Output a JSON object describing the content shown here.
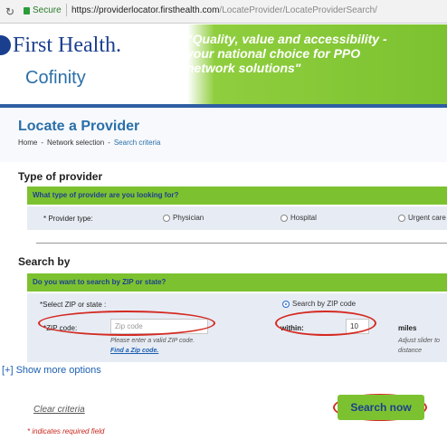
{
  "browser": {
    "reload_icon": "reload-icon",
    "secure_label": "Secure",
    "url_host": "https://providerlocator.firsthealth.com",
    "url_path": "/LocateProvider/LocateProviderSearch/"
  },
  "header": {
    "brand_primary": "First Health.",
    "brand_secondary": "Cofinity",
    "tagline": "\"Quality, value and accessibility - your national choice for PPO network solutions\"",
    "accent_color": "#7cc230",
    "brand_color": "#1b3f8f"
  },
  "page": {
    "title": "Locate a Provider",
    "breadcrumbs": [
      "Home",
      "Network selection",
      "Search criteria"
    ]
  },
  "provider_type": {
    "section_title": "Type of provider",
    "question": "What type of provider are you looking for?",
    "field_label": "* Provider type:",
    "options": [
      "Physician",
      "Hospital",
      "Urgent care"
    ]
  },
  "search_by": {
    "section_title": "Search by",
    "question": "Do you want to search by ZIP or state?",
    "select_label": "*Select ZIP or state :",
    "zip_radio_label": "Search by ZIP code",
    "zip_label": "*ZIP code:",
    "zip_placeholder": "Zip code",
    "zip_hint": "Please enter a valid ZIP code.",
    "find_zip_link": "Find a Zip code.",
    "within_label": "within:",
    "within_value": "10",
    "miles_label": "miles",
    "slider_hint_line1": "Adjust slider to",
    "slider_hint_line2": "distance"
  },
  "actions": {
    "show_more": "[+] Show more options",
    "clear": "Clear criteria",
    "search": "Search now",
    "required_note": "* indicates required field"
  }
}
